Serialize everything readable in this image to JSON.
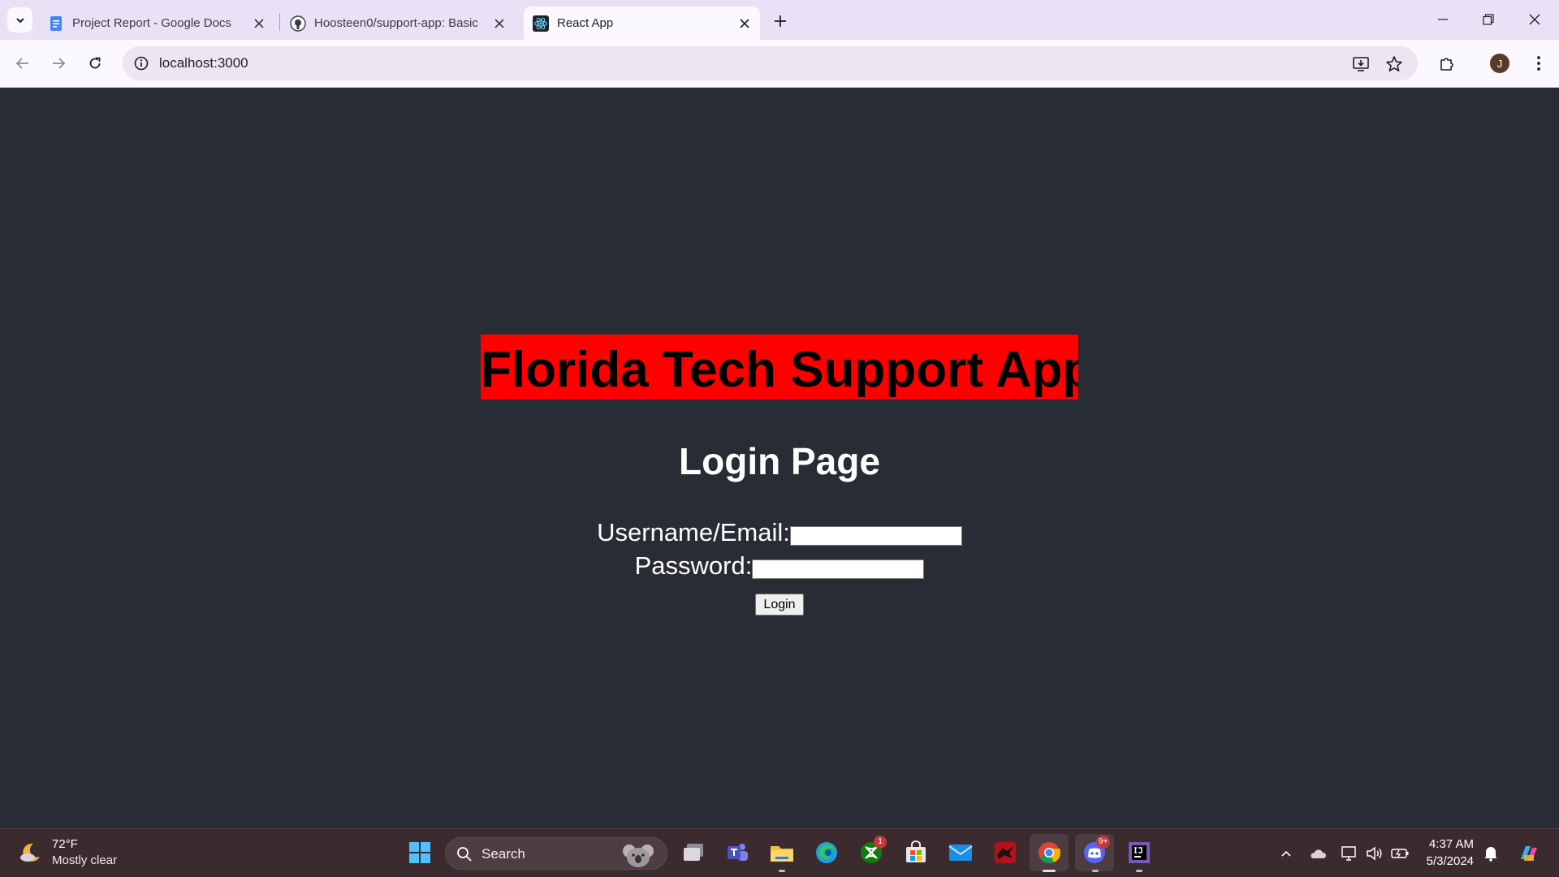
{
  "browser": {
    "tabs": [
      {
        "title": "Project Report - Google Docs",
        "icon": "google-docs-icon"
      },
      {
        "title": "Hoosteen0/support-app: Basic",
        "icon": "github-icon"
      },
      {
        "title": "React App",
        "icon": "react-icon",
        "active": true
      }
    ],
    "url": "localhost:3000",
    "profile_initial": "J"
  },
  "page": {
    "app_title": "Florida Tech Support App",
    "heading": "Login Page",
    "username_label": "Username/Email:",
    "password_label": "Password:",
    "login_button": "Login",
    "colors": {
      "background": "#282c34",
      "title_bg": "#ff0000"
    }
  },
  "taskbar": {
    "weather_temp": "72°F",
    "weather_desc": "Mostly clear",
    "search_label": "Search",
    "xbox_badge": "1",
    "discord_badge": "9+",
    "time": "4:37 AM",
    "date": "5/3/2024"
  }
}
